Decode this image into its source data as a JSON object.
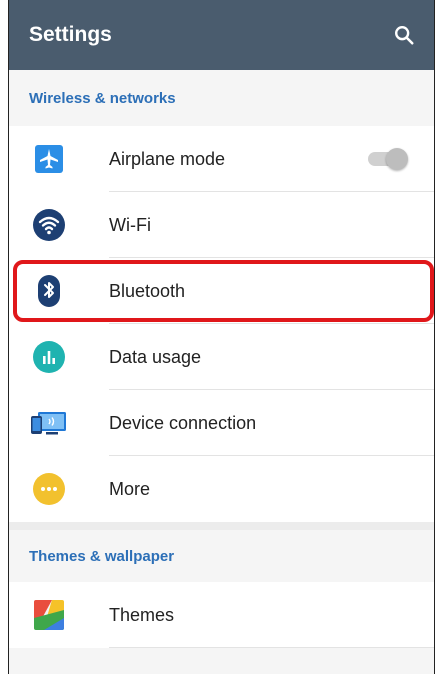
{
  "appbar": {
    "title": "Settings",
    "search_icon": "search-icon"
  },
  "sections": [
    {
      "header": "Wireless & networks",
      "items": [
        {
          "label": "Airplane mode",
          "icon": "airplane-icon",
          "toggle": "off"
        },
        {
          "label": "Wi-Fi",
          "icon": "wifi-icon"
        },
        {
          "label": "Bluetooth",
          "icon": "bluetooth-icon",
          "highlighted": true
        },
        {
          "label": "Data usage",
          "icon": "data-usage-icon"
        },
        {
          "label": "Device connection",
          "icon": "device-connection-icon"
        },
        {
          "label": "More",
          "icon": "more-icon"
        }
      ]
    },
    {
      "header": "Themes & wallpaper",
      "items": [
        {
          "label": "Themes",
          "icon": "themes-icon"
        }
      ]
    }
  ],
  "colors": {
    "appbar": "#4a5c6e",
    "section_header": "#2c6fb7",
    "highlight": "#e0171a"
  }
}
